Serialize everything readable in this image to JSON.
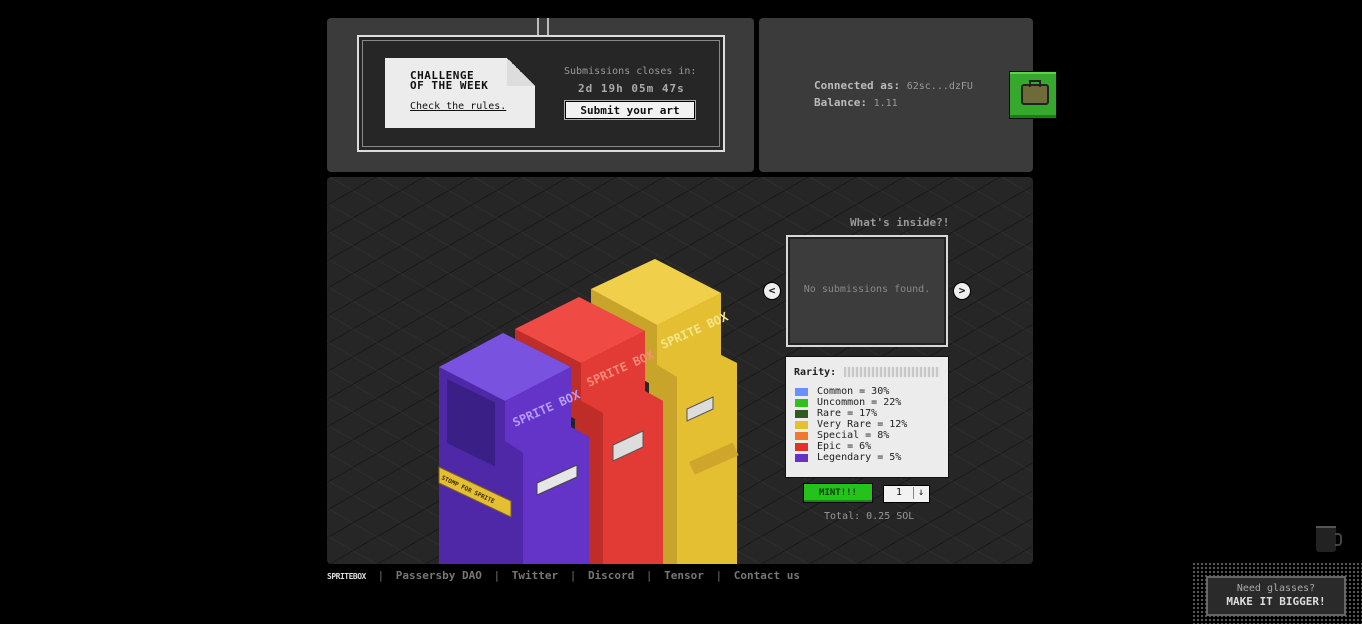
{
  "challenge": {
    "title": "CHALLENGE\nOF THE WEEK",
    "rules_link": "Check the rules.",
    "closes_label": "Submissions closes in:",
    "countdown": "2d 19h 05m 47s",
    "submit_label": "Submit your art"
  },
  "wallet": {
    "connected_label": "Connected as:",
    "connected_value": "62sc...dzFU",
    "balance_label": "Balance:",
    "balance_value": "1.11"
  },
  "machines": {
    "brand_text": "SPRITE BOX",
    "sticker_text": "STOMP FOR SPRITE",
    "colors": {
      "purple": "#6434c9",
      "red": "#e23a35",
      "yellow": "#e5bf32"
    }
  },
  "preview": {
    "heading": "What's inside?!",
    "empty_text": "No submissions found.",
    "prev": "<",
    "next": ">"
  },
  "rarity": {
    "label": "Rarity:",
    "items": [
      {
        "label": "Common = 30%",
        "color": "#6a8fff"
      },
      {
        "label": "Uncommon = 22%",
        "color": "#2ec21a"
      },
      {
        "label": "Rare = 17%",
        "color": "#2f5a1e"
      },
      {
        "label": "Very Rare = 12%",
        "color": "#e5bf32"
      },
      {
        "label": "Special = 8%",
        "color": "#ef7a2d"
      },
      {
        "label": "Epic = 6%",
        "color": "#e2302b"
      },
      {
        "label": "Legendary = 5%",
        "color": "#6434c9"
      }
    ]
  },
  "mint": {
    "button_label": "MINT!!!",
    "quantity": "1",
    "total": "Total: 0.25 SOL"
  },
  "footer": {
    "brand": "SPRITEBOX",
    "links": [
      "Passersby DAO",
      "Twitter",
      "Discord",
      "Tensor",
      "Contact us"
    ]
  },
  "glasses": {
    "line1": "Need glasses?",
    "line2": "MAKE IT BIGGER!"
  }
}
